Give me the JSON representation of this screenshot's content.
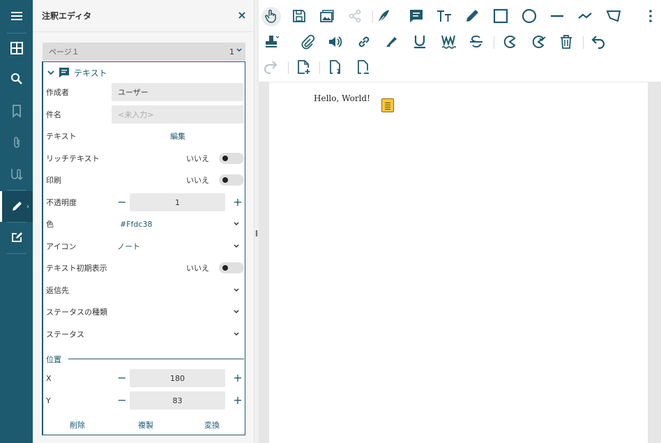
{
  "rail": {
    "items": [
      "menu-icon",
      "thumbnails-icon",
      "search-icon",
      "bookmark-icon",
      "attachment-icon",
      "signature-icon",
      "annotation-edit-icon",
      "form-edit-icon"
    ],
    "expand_glyph": "›"
  },
  "panel": {
    "title": "注釈エディタ",
    "close_glyph": "×",
    "page_select": {
      "label": "ページ１",
      "value": "1"
    },
    "annotation": {
      "type_label": "テキスト",
      "author_label": "作成者",
      "author_value": "ユーザー",
      "subject_label": "件名",
      "subject_placeholder": "<未入力>",
      "text_label": "テキスト",
      "text_edit_link": "編集",
      "rich_text_label": "リッチテキスト",
      "rich_text_value": "いいえ",
      "print_label": "印刷",
      "print_value": "いいえ",
      "opacity_label": "不透明度",
      "opacity_value": "1",
      "color_label": "色",
      "color_value": "#Ffdc38",
      "icon_label": "アイコン",
      "icon_value": "ノート",
      "open_label": "テキスト初期表示",
      "open_value": "いいえ",
      "reply_to_label": "返信先",
      "state_model_label": "ステータスの種類",
      "state_label": "ステータス",
      "position_label": "位置",
      "x_label": "X",
      "x_value": "180",
      "y_label": "Y",
      "y_value": "83",
      "minus_glyph": "−",
      "plus_glyph": "+",
      "delete_label": "削除",
      "clone_label": "複製",
      "convert_label": "変換"
    }
  },
  "splitter_glyph": "‖",
  "toolbar": {
    "row1": [
      "pan-tool-icon",
      "save-icon",
      "image-icon",
      "share-icon",
      "ink-pen-icon",
      "sticky-note-icon",
      "text-icon",
      "pencil-icon",
      "rectangle-icon",
      "circle-icon",
      "line-icon",
      "polyline-icon",
      "polygon-icon",
      "more-vertical-icon"
    ],
    "row2": [
      "stamp-icon",
      "paperclip-icon",
      "sound-icon",
      "link-icon",
      "highlighter-icon",
      "underline-icon",
      "squiggly-icon",
      "strikeout-icon",
      "redact-icon",
      "apply-redact-icon",
      "trash-icon",
      "undo-icon"
    ],
    "row3": [
      "redo-icon",
      "new-page-icon",
      "insert-page-icon",
      "remove-page-icon"
    ]
  },
  "document": {
    "text": "Hello, World!",
    "note_color": "#fdc838"
  },
  "colors": {
    "accent": "#1d5a70",
    "rail_bg": "#1d5a70",
    "note": "#fdc838"
  }
}
